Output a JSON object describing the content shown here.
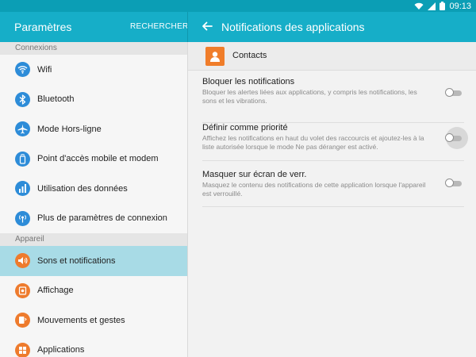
{
  "status": {
    "time": "09:13"
  },
  "header": {
    "left_title": "Paramètres",
    "search_label": "RECHERCHER",
    "right_title": "Notifications des applications"
  },
  "sidebar": {
    "sections": [
      {
        "title": "Connexions",
        "items": [
          {
            "label": "Wifi",
            "icon": "wifi-icon"
          },
          {
            "label": "Bluetooth",
            "icon": "bluetooth-icon"
          },
          {
            "label": "Mode Hors-ligne",
            "icon": "airplane-icon"
          },
          {
            "label": "Point d'accès mobile et modem",
            "icon": "hotspot-icon"
          },
          {
            "label": "Utilisation des données",
            "icon": "data-usage-icon"
          },
          {
            "label": "Plus de paramètres de connexion",
            "icon": "more-connections-icon"
          }
        ]
      },
      {
        "title": "Appareil",
        "items": [
          {
            "label": "Sons et notifications",
            "icon": "sound-icon",
            "active": true
          },
          {
            "label": "Affichage",
            "icon": "display-icon"
          },
          {
            "label": "Mouvements et gestes",
            "icon": "motion-icon"
          },
          {
            "label": "Applications",
            "icon": "apps-icon"
          }
        ]
      }
    ]
  },
  "app": {
    "name": "Contacts",
    "icon": "contacts-icon"
  },
  "options": [
    {
      "title": "Bloquer les notifications",
      "desc": "Bloquer les alertes liées aux applications, y compris les notifications, les sons et les vibrations.",
      "enabled": false
    },
    {
      "title": "Définir comme priorité",
      "desc": "Affichez les notifications en haut du volet des raccourcis et ajoutez-les à la liste autorisée lorsque le mode Ne pas déranger est activé.",
      "enabled": false
    },
    {
      "title": "Masquer sur écran de verr.",
      "desc": "Masquez le contenu des notifications de cette application lorsque l'appareil est verrouillé.",
      "enabled": false
    }
  ],
  "colors": {
    "header": "#16aec8",
    "statusbar": "#0b9eb5",
    "active_item": "#a8dbe6",
    "icon_blue": "#2d8cd8",
    "icon_orange": "#ee7b2d"
  }
}
